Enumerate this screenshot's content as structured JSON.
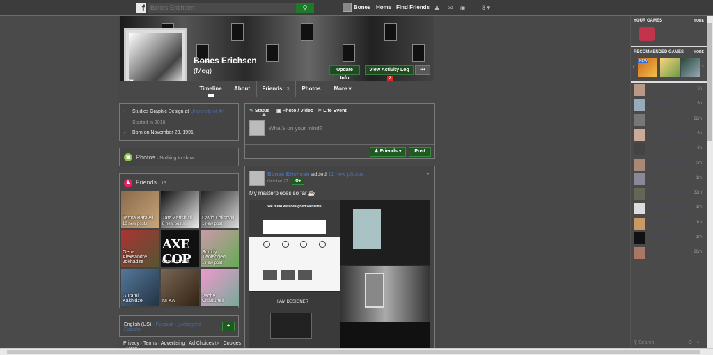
{
  "topbar": {
    "logo": "f",
    "search_placeholder": "Bones Erichsen",
    "user_name": "Bones",
    "home": "Home",
    "find_friends": "Find Friends",
    "menu_badge": "8"
  },
  "profile": {
    "name": "Bones Erichsen",
    "alt_name": "(Meg)",
    "update_info": "Update Info",
    "view_activity": "View Activity Log",
    "activity_count": "2",
    "more_dots": "•••"
  },
  "tabs": {
    "timeline": "Timeline",
    "about": "About",
    "friends": "Friends",
    "friends_count": "13",
    "photos": "Photos",
    "more": "More ▾"
  },
  "intro": {
    "studies_prefix": "Studies Graphic Design at",
    "studies_link": "University of Art",
    "started": "Started in 2016",
    "born": "Born on November 23, 1991"
  },
  "photos_section": {
    "title": "Photos",
    "subtitle": " · Nothing to show"
  },
  "friends_section": {
    "title": "Friends",
    "count": " · 13",
    "items": [
      {
        "name": "Tamta Baraleli",
        "sub": "10 new posts"
      },
      {
        "name": "Tata Zarishvili",
        "sub": "8 new posts"
      },
      {
        "name": "David Lolishvili",
        "sub": "1 new post"
      },
      {
        "name": "Gena Alexsandre Jokhadze",
        "sub": ""
      },
      {
        "name": "Oto Kuprava",
        "sub": ""
      },
      {
        "name": "Squidy Twolegged",
        "sub": "1 new post"
      },
      {
        "name": "Gurami Kakhidze",
        "sub": ""
      },
      {
        "name": "NI KA",
        "sub": ""
      },
      {
        "name": "Vache Chaduneli",
        "sub": ""
      }
    ]
  },
  "language": {
    "current": "English (US)",
    "others": "· Русский · ქართული · Español",
    "add": "+"
  },
  "footer": {
    "links": "Privacy · Terms · Advertising · Ad Choices ▷ · Cookies",
    "more": "· More"
  },
  "composer": {
    "status": "Status",
    "photo_video": "Photo / Video",
    "life_event": "Life Event",
    "placeholder": "What's on your mind?",
    "friends_btn": "Friends ▾",
    "post_btn": "Post"
  },
  "post": {
    "author": "Bones Erichsen",
    "action": "added",
    "action_link": "11 new photos",
    "date": "October 27",
    "text": "My masterpieces so far ☕",
    "web_headline": "We build well designed websites",
    "designer_text": "I AM DESIGNER"
  },
  "rightbar": {
    "your_games": "YOUR GAMES",
    "your_games_more": "MORE",
    "recommended": "RECOMMENDED GAMES",
    "recommended_more": "MORE",
    "new_badge": "NEW",
    "chat": [
      {
        "name": "Squidy Twolegged",
        "time": "5h"
      },
      {
        "name": "Tamta Baraleli",
        "time": "5h"
      },
      {
        "name": "NI KA",
        "time": "22m"
      },
      {
        "name": "Tamara Shengelia",
        "time": "5h"
      },
      {
        "name": "David Lolishvili",
        "time": "6h"
      },
      {
        "name": "Nana Kvaratskhelia",
        "time": "2m"
      },
      {
        "name": "Ani Natsvlishvili",
        "time": "1m"
      },
      {
        "name": "Natia Arughashvili",
        "time": "32m"
      },
      {
        "name": "Tata Zarishvili",
        "time": "1m"
      },
      {
        "name": "Vache Chaduneli",
        "time": "1m"
      },
      {
        "name": "Oto Kuprava",
        "time": "1m"
      },
      {
        "name": "Gena Alexsandre J...",
        "time": "28m"
      }
    ],
    "search_placeholder": "Search"
  },
  "colors": {
    "background": "#484848",
    "accent_green": "#1f5a23",
    "link_blue": "#4a6ea8",
    "badge_red": "#d52a2a"
  }
}
